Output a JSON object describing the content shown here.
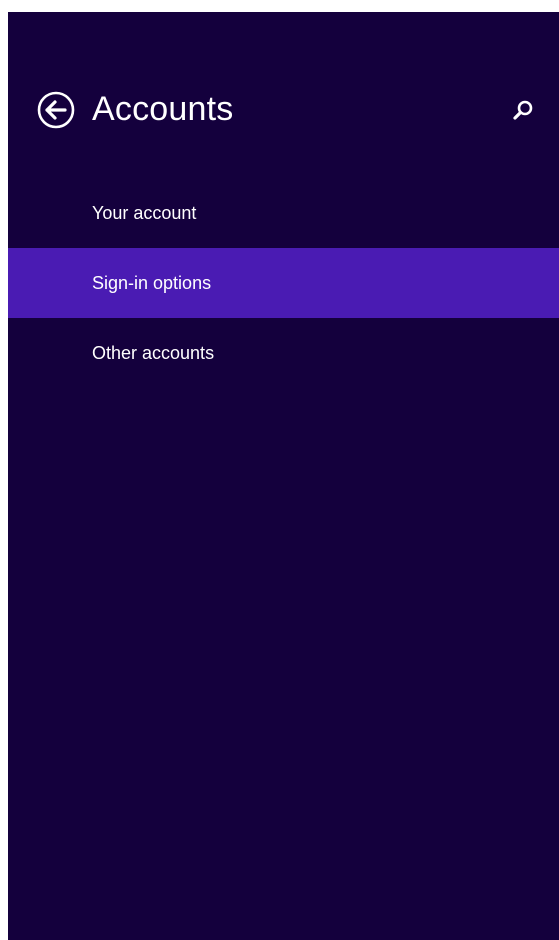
{
  "header": {
    "title": "Accounts",
    "back_icon": "back-arrow-circle-icon",
    "search_icon": "search-icon"
  },
  "nav": {
    "items": [
      {
        "label": "Your account",
        "selected": false
      },
      {
        "label": "Sign-in options",
        "selected": true
      },
      {
        "label": "Other accounts",
        "selected": false
      }
    ]
  },
  "colors": {
    "background": "#14003d",
    "selected": "#4a1bb3",
    "text": "#ffffff"
  }
}
